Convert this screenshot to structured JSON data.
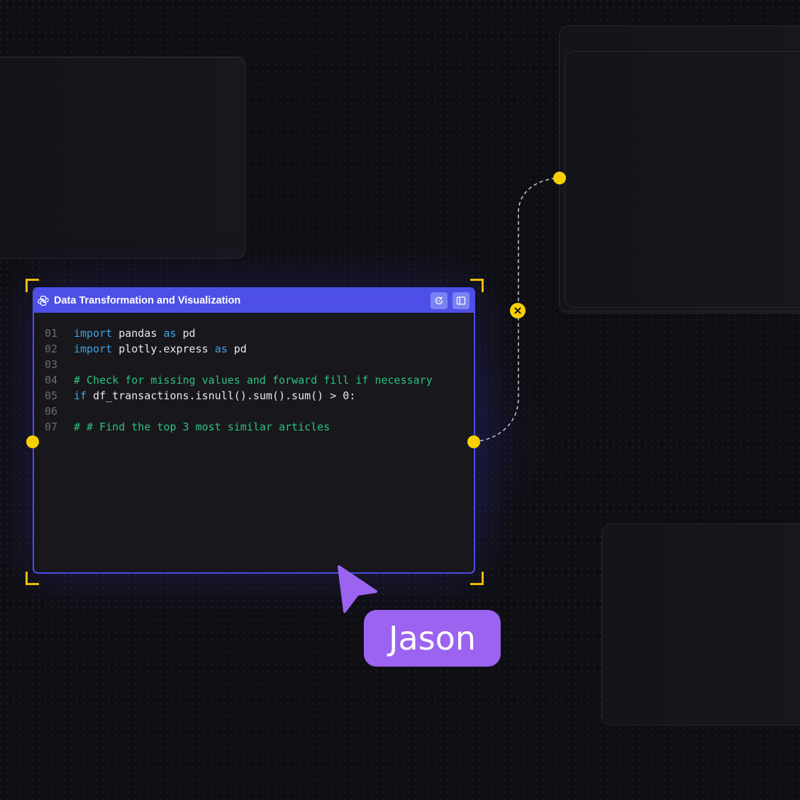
{
  "node": {
    "title": "Data Transformation and Visualization",
    "language_icon": "python-icon",
    "header_buttons": [
      {
        "name": "refresh-icon"
      },
      {
        "name": "sidebar-panel-icon"
      }
    ],
    "code_lines": [
      {
        "number": "01",
        "tokens": [
          {
            "t": "kw",
            "v": "import"
          },
          {
            "t": "id",
            "v": " pandas "
          },
          {
            "t": "kw",
            "v": "as"
          },
          {
            "t": "id",
            "v": " pd"
          }
        ]
      },
      {
        "number": "02",
        "tokens": [
          {
            "t": "kw",
            "v": "import"
          },
          {
            "t": "id",
            "v": " plotly.express "
          },
          {
            "t": "kw",
            "v": "as"
          },
          {
            "t": "id",
            "v": " pd"
          }
        ]
      },
      {
        "number": "03",
        "tokens": []
      },
      {
        "number": "04",
        "tokens": [
          {
            "t": "cm",
            "v": "# Check for missing values and forward fill if necessary"
          }
        ]
      },
      {
        "number": "05",
        "tokens": [
          {
            "t": "kw",
            "v": "if"
          },
          {
            "t": "id",
            "v": " df_transactions.isnull().sum().sum() > 0:"
          }
        ]
      },
      {
        "number": "06",
        "tokens": []
      },
      {
        "number": "07",
        "tokens": [
          {
            "t": "cm",
            "v": "# # Find the top 3 most similar articles"
          }
        ]
      }
    ]
  },
  "collaborator": {
    "name": "Jason",
    "color": "#9b63f0"
  },
  "colors": {
    "accent": "#4d4fe6",
    "port": "#f8d000",
    "selection": "#f5c400",
    "keyword": "#3fa3e6",
    "comment": "#2ec27e"
  }
}
